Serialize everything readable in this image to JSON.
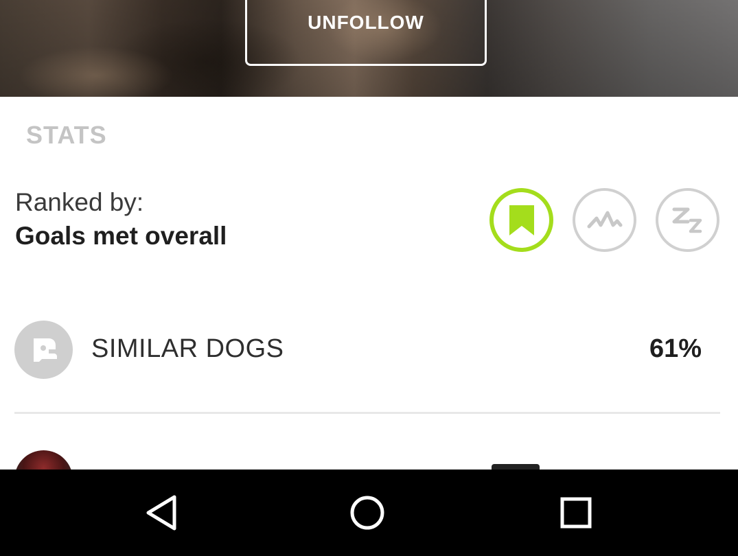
{
  "header": {
    "unfollow_label": "UNFOLLOW"
  },
  "stats": {
    "heading": "STATS",
    "ranked_by_label": "Ranked by:",
    "ranked_by_value": "Goals met overall",
    "rank_options": [
      {
        "icon": "bookmark-icon",
        "selected": true
      },
      {
        "icon": "activity-icon",
        "selected": false
      },
      {
        "icon": "sleep-icon",
        "selected": false
      }
    ],
    "accent_color": "#a4dd1c",
    "inactive_color": "#d0d0d0"
  },
  "rows": [
    {
      "label": "SIMILAR DOGS",
      "value": "61%",
      "icon": "dog-icon"
    }
  ],
  "navbar": {
    "buttons": [
      "back-icon",
      "home-icon",
      "recents-icon"
    ]
  }
}
